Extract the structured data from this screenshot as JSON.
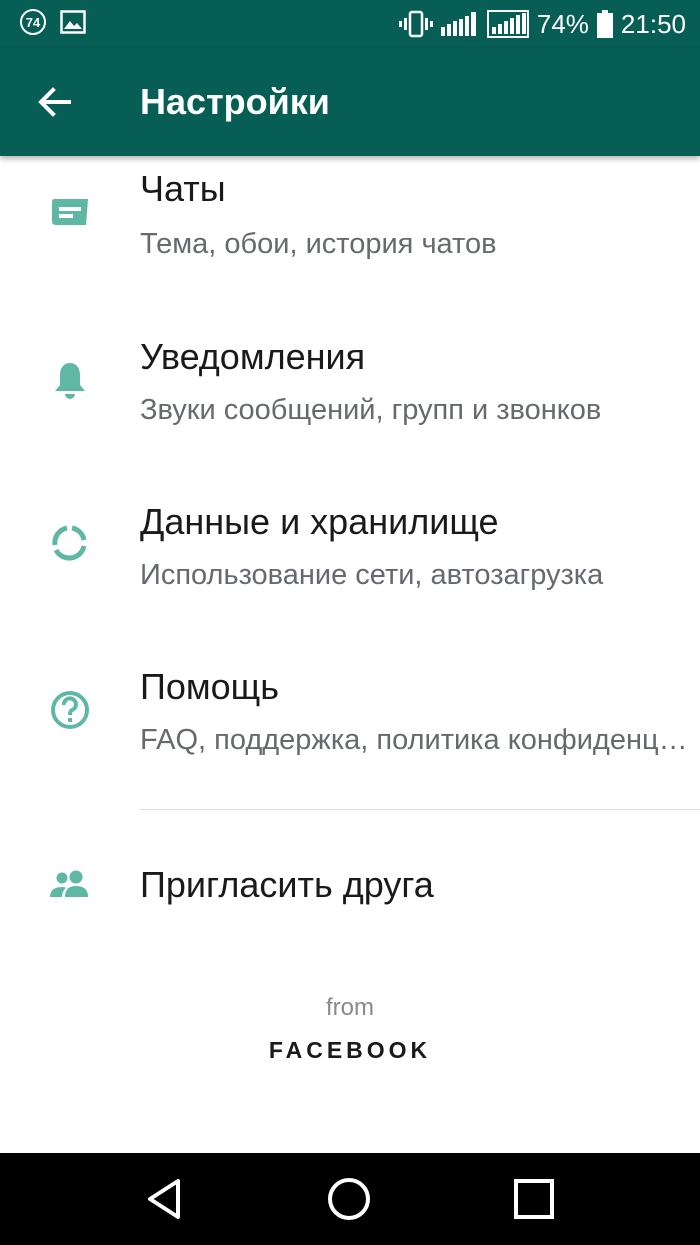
{
  "status_bar": {
    "badge": "74",
    "battery_percent": "74%",
    "time": "21:50",
    "icons": [
      "gallery-icon",
      "vibrate-icon",
      "signal-icon",
      "signal-2-icon",
      "battery-icon"
    ]
  },
  "app_bar": {
    "title": "Настройки",
    "back_icon": "arrow-left-icon"
  },
  "settings": [
    {
      "icon": "chat-icon",
      "title": "Чаты",
      "subtitle": "Тема, обои, история чатов"
    },
    {
      "icon": "bell-icon",
      "title": "Уведомления",
      "subtitle": "Звуки сообщений, групп и звонков"
    },
    {
      "icon": "data-usage-icon",
      "title": "Данные и хранилище",
      "subtitle": "Использование сети, автозагрузка"
    },
    {
      "icon": "help-icon",
      "title": "Помощь",
      "subtitle": "FAQ, поддержка, политика конфиденциальности"
    }
  ],
  "invite": {
    "icon": "people-icon",
    "title": "Пригласить друга"
  },
  "footer": {
    "from": "from",
    "brand": "FACEBOOK"
  },
  "colors": {
    "primary": "#075e54",
    "icon": "#5fb8a6",
    "background": "#ffffff"
  },
  "nav_bar": {
    "icons": [
      "back-triangle-icon",
      "home-circle-icon",
      "recents-square-icon"
    ]
  }
}
